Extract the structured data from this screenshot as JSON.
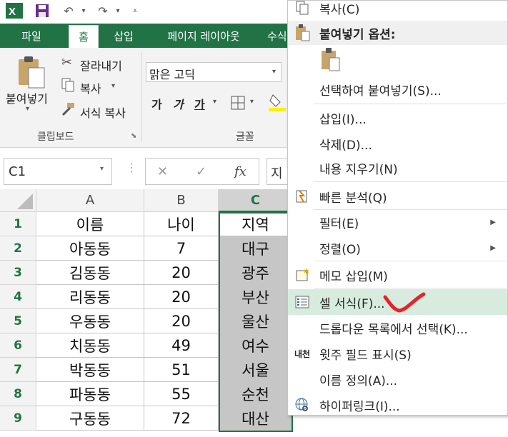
{
  "quick_access": {
    "app_icon": "excel-icon",
    "save_icon": "save-icon",
    "undo_icon": "undo-icon",
    "redo_icon": "redo-icon",
    "customize_icon": "customize-qat-icon"
  },
  "ribbon_tabs": [
    "파일",
    "홈",
    "삽입",
    "페이지 레이아웃",
    "수식"
  ],
  "ribbon": {
    "paste_label": "붙여넣기",
    "cut_label": "잘라내기",
    "copy_label": "복사",
    "format_painter_label": "서식 복사",
    "clipboard_group": "클립보드",
    "font_name": "맑은 고딕",
    "bold": "가",
    "italic": "가",
    "underline": "가",
    "font_group": "글꼴"
  },
  "formula_bar": {
    "name_box": "C1",
    "cancel_icon": "close-icon",
    "enter_icon": "check-icon",
    "fx_label": "fx",
    "content": "지"
  },
  "grid": {
    "columns": [
      "A",
      "B",
      "C"
    ],
    "selected_column": "C",
    "rows": [
      {
        "num": "1",
        "a": "이름",
        "b": "나이",
        "c": "지역"
      },
      {
        "num": "2",
        "a": "아동동",
        "b": "7",
        "c": "대구"
      },
      {
        "num": "3",
        "a": "김동동",
        "b": "20",
        "c": "광주"
      },
      {
        "num": "4",
        "a": "리동동",
        "b": "20",
        "c": "부산"
      },
      {
        "num": "5",
        "a": "우동동",
        "b": "20",
        "c": "울산"
      },
      {
        "num": "6",
        "a": "치동동",
        "b": "49",
        "c": "여수"
      },
      {
        "num": "7",
        "a": "박동동",
        "b": "51",
        "c": "서울"
      },
      {
        "num": "8",
        "a": "파동동",
        "b": "55",
        "c": "순천"
      },
      {
        "num": "9",
        "a": "구동동",
        "b": "72",
        "c": "대산"
      }
    ]
  },
  "context_menu": {
    "copy": "복사(C)",
    "paste_options": "붙여넣기 옵션:",
    "paste_special": "선택하여 붙여넣기(S)...",
    "insert": "삽입(I)...",
    "delete": "삭제(D)...",
    "clear_contents": "내용 지우기(N)",
    "quick_analysis": "빠른 분석(Q)",
    "filter": "필터(E)",
    "sort": "정렬(O)",
    "insert_comment": "메모 삽입(M)",
    "format_cells": "셀 서식(F)...",
    "pick_from_list": "드롭다운 목록에서 선택(K)...",
    "phonetic": "윗주 필드 표시(S)",
    "define_name": "이름 정의(A)...",
    "hyperlink": "하이퍼링크(I)...",
    "phonetic_icon_text": "내천"
  },
  "colors": {
    "excel_green": "#217346",
    "hover": "#d7ecdf",
    "annotation_red": "#e8212b"
  }
}
